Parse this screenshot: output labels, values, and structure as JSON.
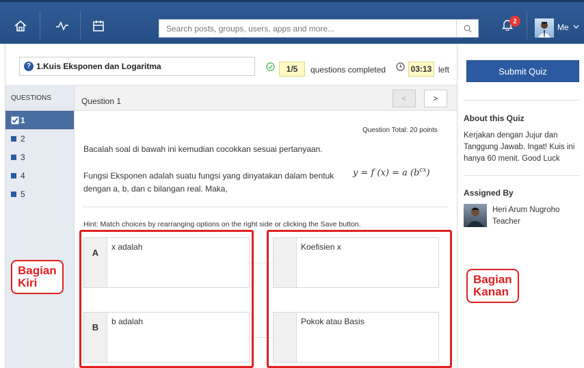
{
  "topbar": {
    "search_placeholder": "Search posts, groups, users, apps and more...",
    "notification_count": "2",
    "user_label": "Me",
    "icons": [
      "home-icon",
      "activity-icon",
      "calendar-icon",
      "search-icon",
      "bell-icon",
      "chevron-down-icon"
    ]
  },
  "quiz": {
    "title": "1.Kuis Eksponen dan Logaritma",
    "progress": "1/5",
    "progress_label": "questions completed",
    "timer": "03:13",
    "timer_label": "left",
    "submit_label": "Submit Quiz"
  },
  "questions_panel": {
    "header": "QUESTIONS",
    "items": [
      {
        "label": "1",
        "active": true
      },
      {
        "label": "2",
        "active": false
      },
      {
        "label": "3",
        "active": false
      },
      {
        "label": "4",
        "active": false
      },
      {
        "label": "5",
        "active": false
      }
    ]
  },
  "question": {
    "label": "Question 1",
    "prev_label": "<",
    "next_label": ">",
    "total": "Question Total: 20 points",
    "text1": "Bacalah soal di bawah ini kemudian cocokkan sesuai pertanyaan.",
    "text2": "Fungsi Eksponen adalah suatu fungsi yang dinyatakan dalam bentuk",
    "formula_main": "y = f (x) = a (b",
    "formula_sup": "cx",
    "formula_close": ")",
    "text3": "dengan a, b, dan c bilangan real. Maka,",
    "hint": "Hint: Match choices by rearranging options on the right side or clicking the Save button."
  },
  "matches": {
    "left": [
      {
        "letter": "A",
        "text": "x adalah"
      },
      {
        "letter": "B",
        "text": "b adalah"
      }
    ],
    "right": [
      {
        "text": "Koefisien x"
      },
      {
        "text": "Pokok atau Basis"
      }
    ]
  },
  "annotations": {
    "left_line1": "Bagian",
    "left_line2": "Kiri",
    "right_line1": "Bagian",
    "right_line2": "Kanan",
    "color": "#e02020"
  },
  "sidebar": {
    "about_title": "About this Quiz",
    "about_text": "Kerjakan dengan Jujur dan Tanggung Jawab. Ingat! Kuis ini hanya 60 menit. Good Luck",
    "assigned_title": "Assigned By",
    "teacher_name": "Heri Arum Nugroho",
    "teacher_role": "Teacher"
  },
  "colors": {
    "topbar": "#2f5a94",
    "accent": "#2c5aa0",
    "highlight": "#fff9c4"
  }
}
